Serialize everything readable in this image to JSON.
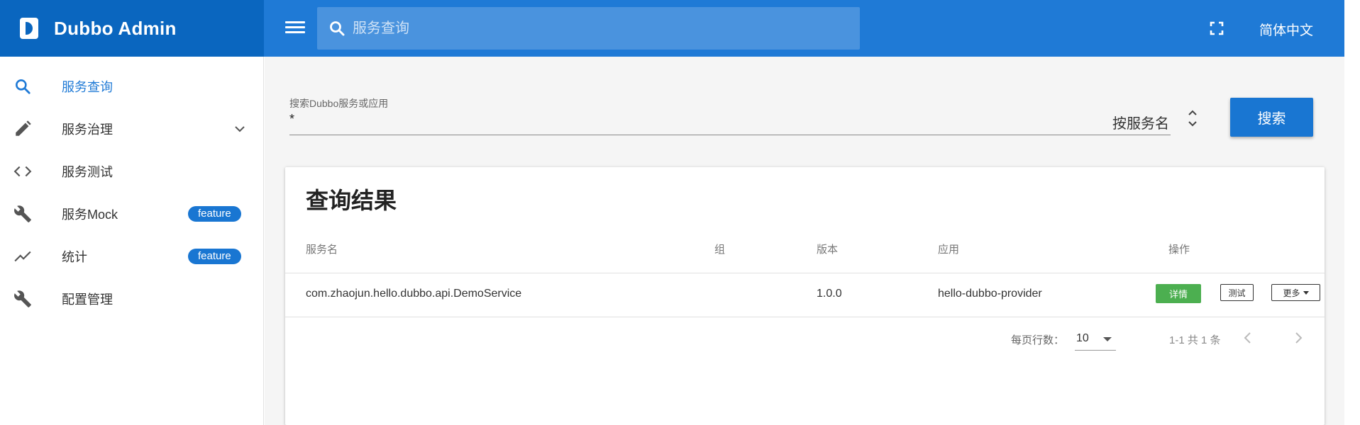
{
  "app": {
    "title": "Dubbo Admin"
  },
  "header": {
    "search_placeholder": "服务查询",
    "language": "简体中文"
  },
  "sidebar": {
    "items": [
      {
        "label": "服务查询",
        "icon": "search-icon",
        "active": true
      },
      {
        "label": "服务治理",
        "icon": "pencil-icon",
        "expandable": true
      },
      {
        "label": "服务测试",
        "icon": "code-icon"
      },
      {
        "label": "服务Mock",
        "icon": "wrench-icon",
        "badge": "feature"
      },
      {
        "label": "统计",
        "icon": "trend-icon",
        "badge": "feature"
      },
      {
        "label": "配置管理",
        "icon": "wrench-icon"
      }
    ]
  },
  "search": {
    "label": "搜索Dubbo服务或应用",
    "value": "*",
    "mode": "按服务名",
    "button": "搜索"
  },
  "results": {
    "title": "查询结果",
    "columns": [
      "服务名",
      "组",
      "版本",
      "应用",
      "操作"
    ],
    "rows": [
      {
        "service": "com.zhaojun.hello.dubbo.api.DemoService",
        "group": "",
        "version": "1.0.0",
        "app": "hello-dubbo-provider"
      }
    ],
    "actions": {
      "detail": "详情",
      "test": "测试",
      "more": "更多"
    },
    "pagination": {
      "rows_per_page_label": "每页行数：",
      "rows_per_page": "10",
      "range": "1-1 共 1 条"
    }
  },
  "colors": {
    "primary": "#1f7ad6",
    "brand": "#0a66bf",
    "success": "#4caf50",
    "badge": "#1976d2"
  }
}
